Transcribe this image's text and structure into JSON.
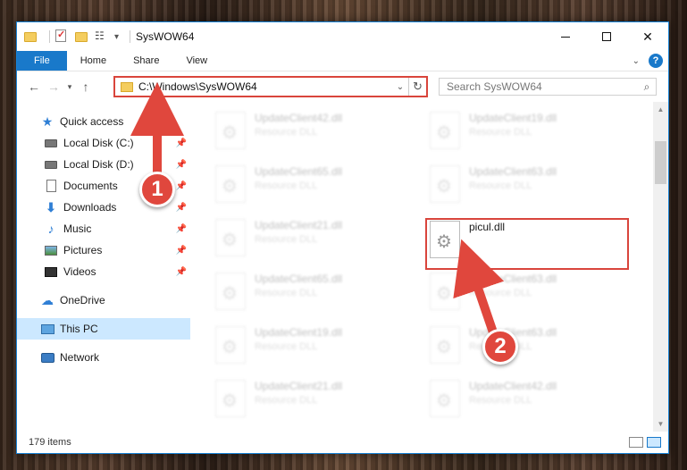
{
  "window": {
    "title": "SysWOW64",
    "accent": "#1979ca"
  },
  "ribbon": {
    "tabs": [
      "File",
      "Home",
      "Share",
      "View"
    ],
    "help_label": "?"
  },
  "navbar": {
    "address": "C:\\Windows\\SysWOW64",
    "search_placeholder": "Search SysWOW64"
  },
  "sidebar": {
    "items": [
      {
        "label": "Quick access",
        "icon": "star-icon"
      },
      {
        "label": "Local Disk (C:)",
        "icon": "disk-icon"
      },
      {
        "label": "Local Disk (D:)",
        "icon": "disk-icon"
      },
      {
        "label": "Documents",
        "icon": "document-icon"
      },
      {
        "label": "Downloads",
        "icon": "download-icon"
      },
      {
        "label": "Music",
        "icon": "music-icon"
      },
      {
        "label": "Pictures",
        "icon": "pictures-icon"
      },
      {
        "label": "Videos",
        "icon": "videos-icon"
      },
      {
        "label": "OneDrive",
        "icon": "cloud-icon"
      },
      {
        "label": "This PC",
        "icon": "pc-icon"
      },
      {
        "label": "Network",
        "icon": "network-icon"
      }
    ]
  },
  "files": [
    {
      "name": "UpdateClient42.dll",
      "type": "Resource DLL"
    },
    {
      "name": "UpdateClient19.dll",
      "type": "Resource DLL"
    },
    {
      "name": "UpdateClient65.dll",
      "type": "Resource DLL"
    },
    {
      "name": "UpdateClient63.dll",
      "type": "Resource DLL"
    },
    {
      "name": "UpdateClient21.dll",
      "type": "Resource DLL"
    },
    {
      "name": "picul.dll",
      "type": ""
    },
    {
      "name": "UpdateClient65.dll",
      "type": "Resource DLL"
    },
    {
      "name": "UpdateClient63.dll",
      "type": "Resource DLL"
    },
    {
      "name": "UpdateClient19.dll",
      "type": "Resource DLL"
    },
    {
      "name": "UpdateClient63.dll",
      "type": "Resource DLL"
    },
    {
      "name": "UpdateClient21.dll",
      "type": "Resource DLL"
    },
    {
      "name": "UpdateClient42.dll",
      "type": "Resource DLL"
    }
  ],
  "status": {
    "item_count": "179 items"
  },
  "annotations": {
    "step1": "1",
    "step2": "2",
    "color": "#e0473d"
  }
}
